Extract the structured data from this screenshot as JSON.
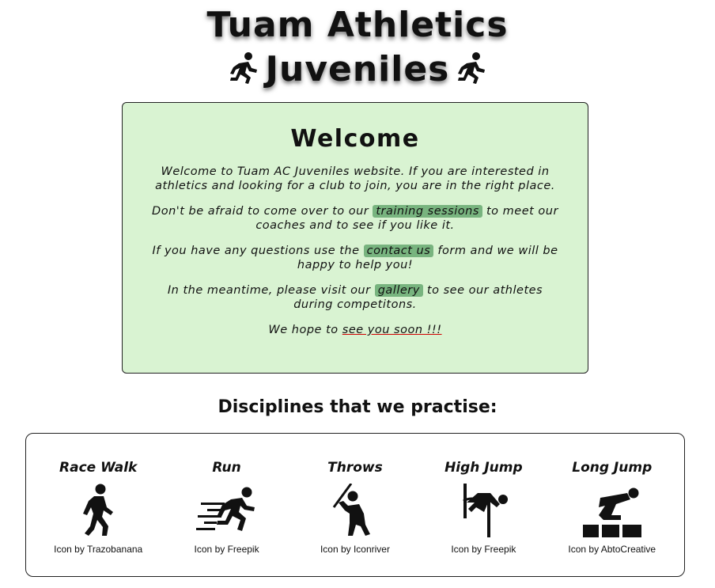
{
  "header": {
    "title_line1": "Tuam Athletics",
    "title_line2": "Juveniles"
  },
  "welcome": {
    "heading": "Welcome",
    "p1": "Welcome to Tuam AC Juveniles website. If you are interested in athletics and looking for a club to join, you are in the right place.",
    "p2_before": "Don't be afraid to come over to our ",
    "p2_link": "training sessions",
    "p2_after": " to meet our coaches and to see if you like it.",
    "p3_before": "If you have any questions use the ",
    "p3_link": "contact us",
    "p3_after": " form and we will be happy to help you!",
    "p4_before": "In the meantime, please visit our ",
    "p4_link": "gallery",
    "p4_after": " to see our athletes during competitons.",
    "p5_before": "We hope to ",
    "p5_link": "see you soon !!!",
    "link_highlight_color": "#78b47f",
    "box_background": "#d9f3d2"
  },
  "disciplines": {
    "heading": "Disciplines that we practise:",
    "items": [
      {
        "name": "Race Walk",
        "icon": "race-walk-icon",
        "credit": "Icon by Trazobanana"
      },
      {
        "name": "Run",
        "icon": "run-icon",
        "credit": "Icon by Freepik"
      },
      {
        "name": "Throws",
        "icon": "throws-icon",
        "credit": "Icon by Iconriver"
      },
      {
        "name": "High Jump",
        "icon": "high-jump-icon",
        "credit": "Icon by Freepik"
      },
      {
        "name": "Long Jump",
        "icon": "long-jump-icon",
        "credit": "Icon by AbtoCreative"
      }
    ]
  }
}
